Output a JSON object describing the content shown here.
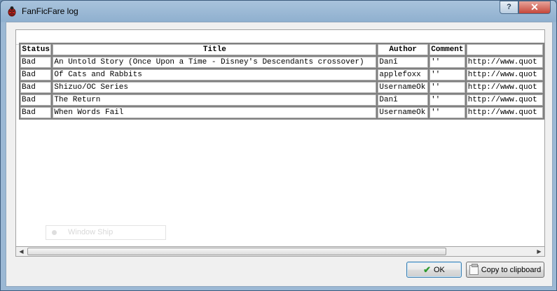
{
  "window": {
    "title": "FanFicFare log",
    "help_label": "?",
    "close_label": "✕",
    "icon": "ladybug-icon"
  },
  "table": {
    "columns": [
      "Status",
      "Title",
      "Author",
      "Comment",
      ""
    ],
    "rows": [
      {
        "status": "Bad",
        "title": "An Untold Story (Once Upon a Time - Disney's Descendants crossover)",
        "author": "Danî",
        "comment": "''",
        "url": "http://www.quot"
      },
      {
        "status": "Bad",
        "title": "Of Cats and Rabbits",
        "author": "applefoxx",
        "comment": "''",
        "url": "http://www.quot"
      },
      {
        "status": "Bad",
        "title": "Shizuo/OC Series",
        "author": "UsernameOk",
        "comment": "''",
        "url": "http://www.quot"
      },
      {
        "status": "Bad",
        "title": "The Return",
        "author": "Danî",
        "comment": "''",
        "url": "http://www.quot"
      },
      {
        "status": "Bad",
        "title": "When Words Fail",
        "author": "UsernameOk",
        "comment": "''",
        "url": "http://www.quot"
      }
    ]
  },
  "background_ghost": {
    "panel_label": "Window Ship"
  },
  "buttons": {
    "ok_label": "OK",
    "ok_icon": "checkmark-icon",
    "copy_label": "Copy to clipboard",
    "copy_icon": "clipboard-icon"
  }
}
